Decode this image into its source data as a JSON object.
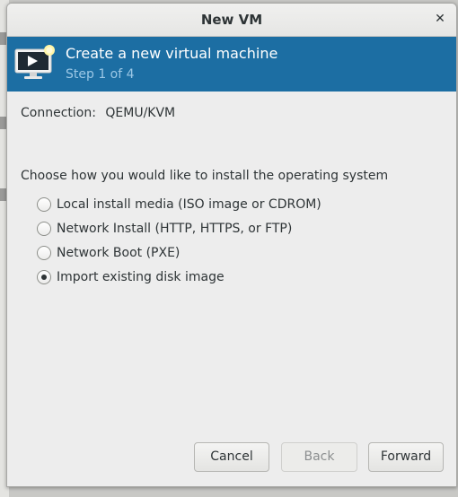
{
  "window": {
    "title": "New VM",
    "close_glyph": "✕"
  },
  "banner": {
    "title": "Create a new virtual machine",
    "subtitle": "Step 1 of 4",
    "icon": "monitor-play-icon",
    "background_color": "#1c6ea3"
  },
  "connection": {
    "label": "Connection:",
    "value": "QEMU/KVM"
  },
  "install": {
    "question": "Choose how you would like to install the operating system",
    "options": [
      {
        "label": "Local install media (ISO image or CDROM)",
        "selected": false
      },
      {
        "label": "Network Install (HTTP, HTTPS, or FTP)",
        "selected": false
      },
      {
        "label": "Network Boot (PXE)",
        "selected": false
      },
      {
        "label": "Import existing disk image",
        "selected": true
      }
    ]
  },
  "buttons": {
    "cancel": "Cancel",
    "back": "Back",
    "forward": "Forward"
  }
}
